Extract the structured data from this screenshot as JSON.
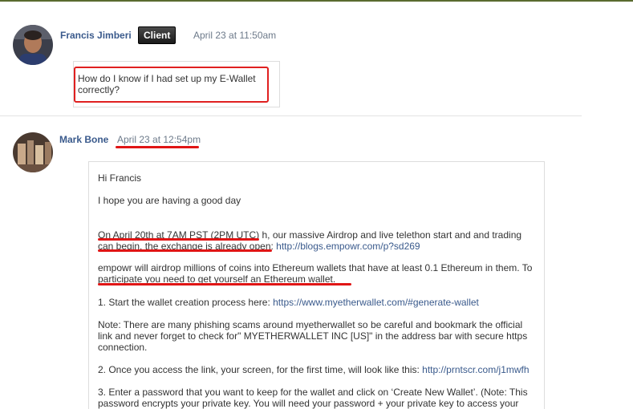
{
  "comment1": {
    "author": "Francis Jimberi",
    "badge": "Client",
    "time": "April 23 at 11:50am",
    "text": "How do I know if I had set up my E-Wallet correctly?"
  },
  "comment2": {
    "author": "Mark Bone",
    "time": "April 23 at 12:54pm",
    "greeting": "Hi Francis",
    "p1": "I hope you are having a good day",
    "p2_text": "On April 20th at 7AM PST (2PM UTC) h, our massive Airdrop and live telethon start and and trading can begin, the exchange is already open: ",
    "p2_link": "http://blogs.empowr.com/p?sd269",
    "p3": "empowr will airdrop millions of coins into Ethereum wallets that have at least 0.1 Ethereum in them. To participate you need to get yourself an Ethereum wallet.",
    "p4_text": "1. Start the wallet creation process here: ",
    "p4_link": "https://www.myetherwallet.com/#generate-wallet",
    "p5": "Note: There are many phishing scams around myetherwallet so be careful and bookmark the official link and never forget to check for\" MYETHERWALLET INC [US]\" in the address bar with secure https connection.",
    "p6_text": "2. Once you access the link, your screen, for the first time, will look like this: ",
    "p6_link": "http://prntscr.com/j1mwfh",
    "p7": "3. Enter a password that you want to keep for the wallet and click on ‘Create New Wallet’. (Note: This password encrypts your private key. You will need your password + your private key to access your"
  },
  "colors": {
    "link": "#3a5a8c",
    "annotation_red": "#e02020",
    "badge_bg": "#1a1a1a"
  }
}
